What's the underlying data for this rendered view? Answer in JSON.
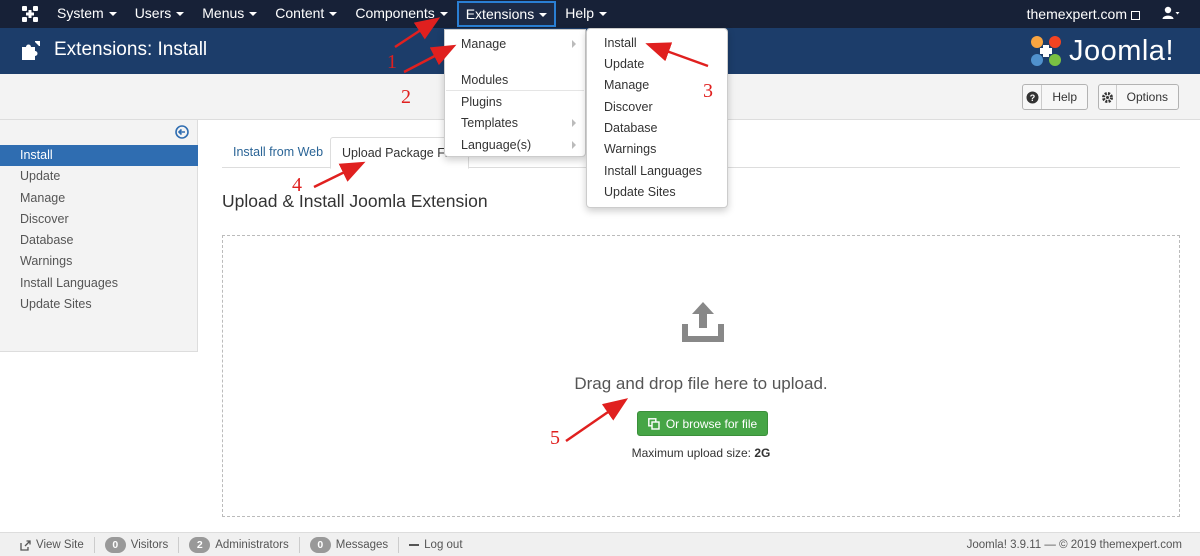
{
  "topnav": {
    "items": [
      {
        "label": "System"
      },
      {
        "label": "Users"
      },
      {
        "label": "Menus"
      },
      {
        "label": "Content"
      },
      {
        "label": "Components"
      },
      {
        "label": "Extensions"
      },
      {
        "label": "Help"
      }
    ],
    "site_link": "themexpert.com",
    "user_icon": "user-icon"
  },
  "header": {
    "title": "Extensions: Install",
    "brand": "Joomla!"
  },
  "toolbar": {
    "help_label": "Help",
    "options_label": "Options"
  },
  "sidebar": {
    "items": [
      {
        "label": "Install",
        "active": true
      },
      {
        "label": "Update"
      },
      {
        "label": "Manage"
      },
      {
        "label": "Discover"
      },
      {
        "label": "Database"
      },
      {
        "label": "Warnings"
      },
      {
        "label": "Install Languages"
      },
      {
        "label": "Update Sites"
      }
    ]
  },
  "tabs": {
    "web": "Install from Web",
    "upload": "Upload Package File"
  },
  "main": {
    "title": "Upload & Install Joomla Extension",
    "drop_text": "Drag and drop file here to upload.",
    "browse_label": "Or browse for file",
    "max_label": "Maximum upload size:",
    "max_value": "2G"
  },
  "extensions_menu": {
    "items": [
      "Manage",
      "Modules",
      "Plugins",
      "Templates",
      "Language(s)"
    ]
  },
  "manage_menu": {
    "items": [
      "Install",
      "Update",
      "Manage",
      "Discover",
      "Database",
      "Warnings",
      "Install Languages",
      "Update Sites"
    ]
  },
  "annotations": [
    "1",
    "2",
    "3",
    "4",
    "5"
  ],
  "footer": {
    "view_site": "View Site",
    "visitors_count": "0",
    "visitors_label": "Visitors",
    "admins_count": "2",
    "admins_label": "Administrators",
    "messages_count": "0",
    "messages_label": "Messages",
    "logout": "Log out",
    "version": "Joomla! 3.9.11 — © 2019 themexpert.com"
  },
  "colors": {
    "navbar": "#172137",
    "header": "#1c3d6a",
    "active_sidebar": "#2f6db1",
    "browse_button": "#46a546",
    "annotation": "#e0201f"
  }
}
